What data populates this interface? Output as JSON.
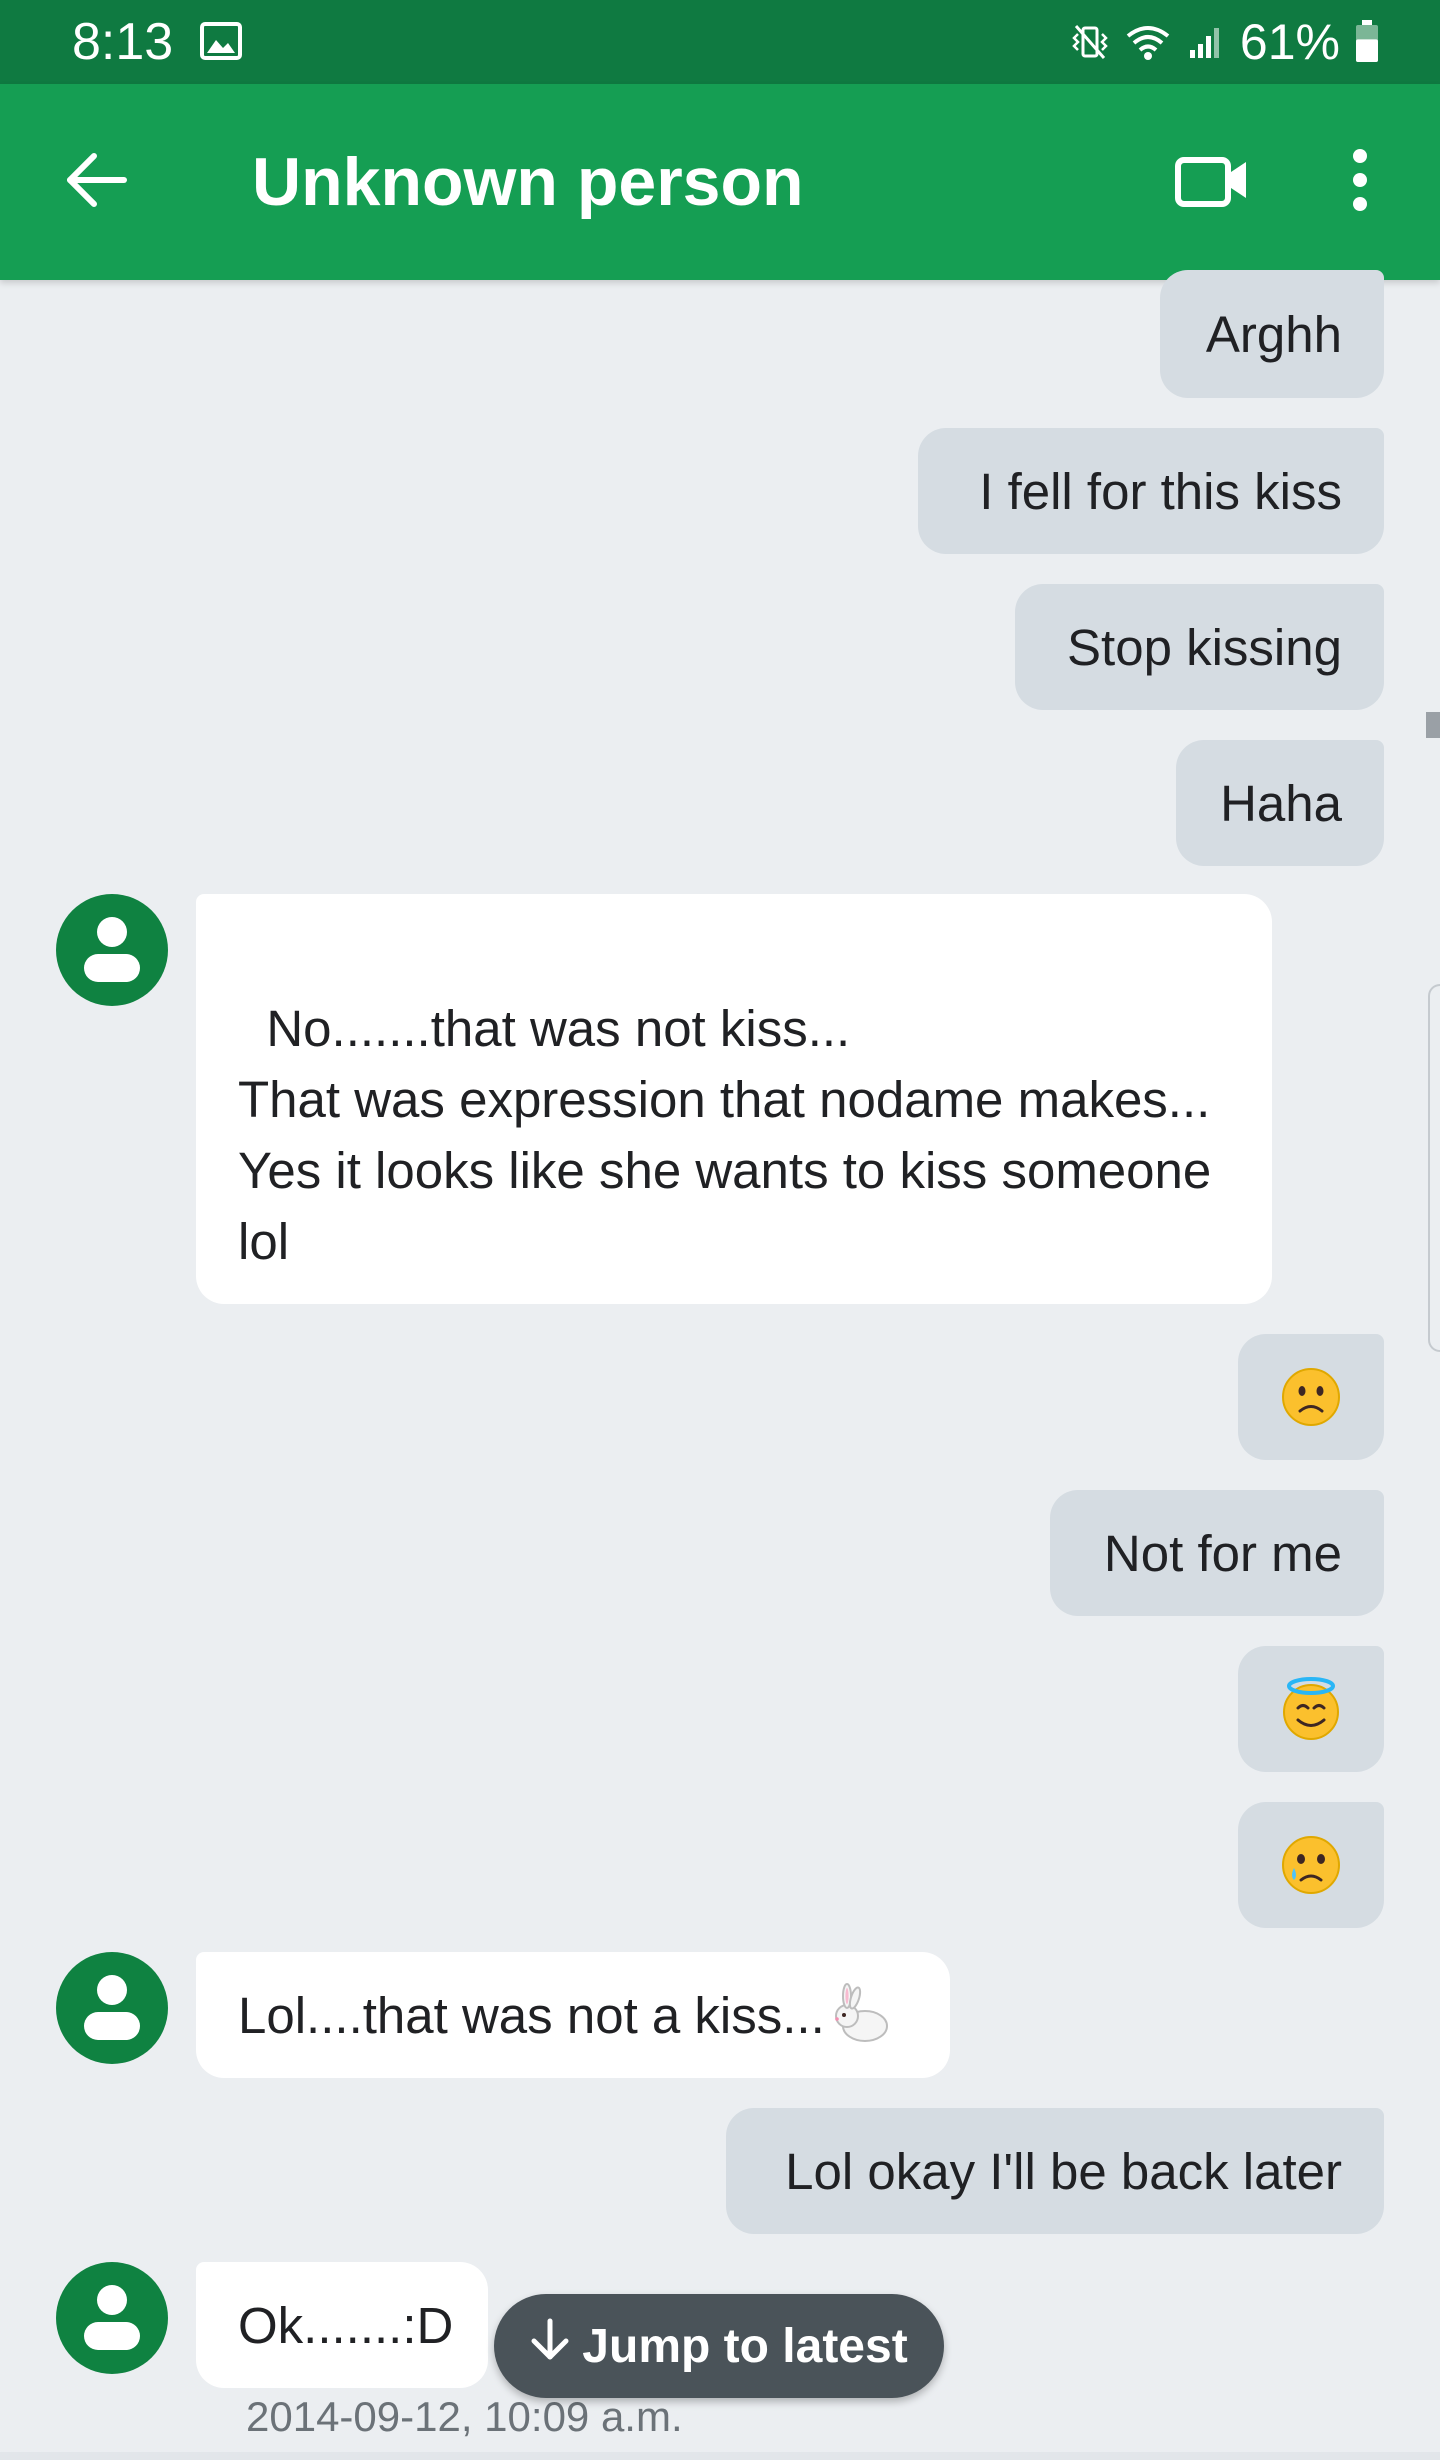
{
  "status_bar": {
    "time": "8:13",
    "battery_percent": "61%",
    "battery_level": 0.61,
    "icons": [
      "gallery-icon",
      "vibrate-icon",
      "wifi-icon",
      "signal-icon",
      "battery-icon"
    ]
  },
  "app_bar": {
    "title": "Unknown person",
    "back_icon": "arrow-left-icon",
    "video_icon": "video-call-icon",
    "more_icon": "more-vert-icon"
  },
  "colors": {
    "status_bar": "#0f7a41",
    "app_bar": "#159e53",
    "avatar": "#0f8241",
    "outgoing_bubble": "#d5dce2",
    "incoming_bubble": "#ffffff",
    "thread_background": "#ebeef1",
    "jump_button": "#4a5359"
  },
  "messages": [
    {
      "direction": "outgoing",
      "text": "Arghh"
    },
    {
      "direction": "outgoing",
      "text": "I fell for this kiss"
    },
    {
      "direction": "outgoing",
      "text": "Stop kissing"
    },
    {
      "direction": "outgoing",
      "text": "Haha"
    },
    {
      "direction": "incoming",
      "text": "No.......that was not kiss...\nThat was expression that nodame makes...\nYes it looks like she wants to kiss someone lol"
    },
    {
      "direction": "outgoing",
      "emoji": "slightly-frowning-face-emoji"
    },
    {
      "direction": "outgoing",
      "text": "Not for me"
    },
    {
      "direction": "outgoing",
      "emoji": "smiling-face-with-halo-emoji"
    },
    {
      "direction": "outgoing",
      "emoji": "crying-face-emoji"
    },
    {
      "direction": "incoming",
      "text": "Lol....that was not a kiss...",
      "emoji": "rabbit-emoji"
    },
    {
      "direction": "outgoing",
      "text": "Lol okay I'll be back later"
    },
    {
      "direction": "incoming",
      "text": "Ok.......:D"
    }
  ],
  "jump_to_latest": {
    "label": "Jump to latest",
    "icon": "arrow-down-icon"
  },
  "last_timestamp": "2014-09-12, 10:09 a.m."
}
